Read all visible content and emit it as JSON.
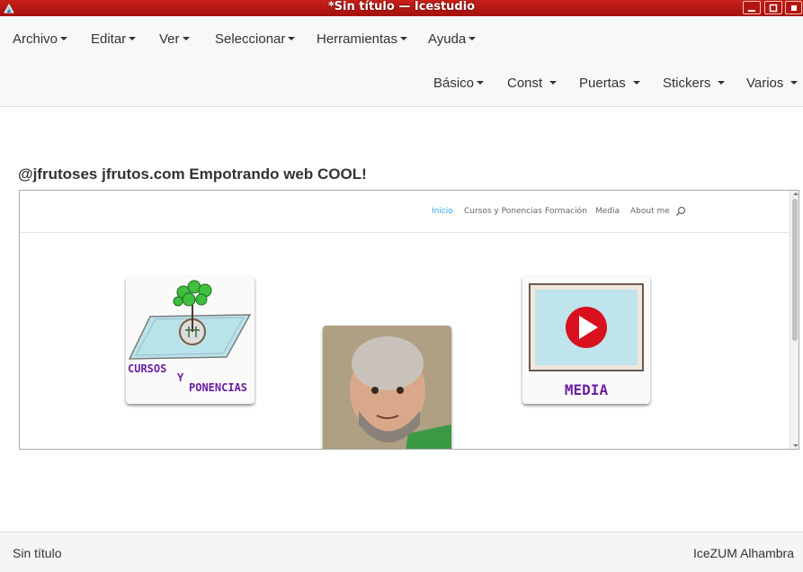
{
  "window": {
    "title": "*Sin título — Icestudio"
  },
  "menubar": {
    "top": [
      "Archivo",
      "Editar",
      "Ver",
      "Seleccionar",
      "Herramientas",
      "Ayuda"
    ],
    "blocks": [
      "Básico",
      "Const",
      "Puertas",
      "Stickers",
      "Varios"
    ]
  },
  "block": {
    "title": "@jfrutoses jfrutos.com Empotrando web COOL!"
  },
  "site": {
    "nav": [
      "Inicio",
      "Cursos y Ponencias",
      "Formación",
      "Media",
      "About me"
    ],
    "cards": {
      "cursos_line1": "CURSOS",
      "cursos_line2": "Y",
      "cursos_line3": "PONENCIAS",
      "media": "MEDIA"
    }
  },
  "statusbar": {
    "left": "Sin título",
    "right": "IceZUM Alhambra"
  },
  "colors": {
    "titlebar": "#b5150f",
    "nav_active": "#2ea3f2",
    "card_text": "#6a1fa0",
    "tree_green": "#3fbf3f",
    "play_red": "#d9101e"
  }
}
